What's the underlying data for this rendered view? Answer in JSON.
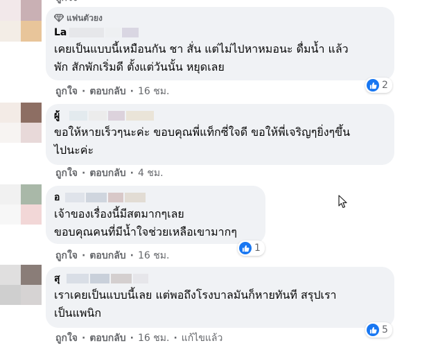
{
  "comments": [
    {
      "badge": "แฟนตัวยง",
      "name": "La",
      "text": "เคยเป็นแบบนี้เหมือนกัน ชา สั่น แต่ไม่ไปหาหมอนะ ดื่มน้ำ แล้ว\nพัก สักพักเริ่มดี ตั้งแต่วันนั้น หยุดเลย",
      "like_label": "ถูกใจ",
      "reply_label": "ตอบกลับ",
      "time": "16 ชม.",
      "reactions": "2"
    },
    {
      "name": "ผู้",
      "text": "ขอให้หายเร็วๆนะค่ะ ขอบคุณพี่แท็กซี่ใจดี ขอให้พี่เจริญๆยิ่งๆขึ้น\nไปนะค่ะ",
      "like_label": "ถูกใจ",
      "reply_label": "ตอบกลับ",
      "time": "4 ชม."
    },
    {
      "name": "อ",
      "text": "เจ้าของเรื่องนี้มีสตมากๆเลย\nขอบคุณคนที่มีน้ำใจช่วยเหลือเขามากๆ",
      "like_label": "ถูกใจ",
      "reply_label": "ตอบกลับ",
      "time": "16 ชม.",
      "reactions": "1"
    },
    {
      "name": "สุ",
      "text": "เราเคยเป็นแบบนี้เลย แต่พอถึงโรงบาลมันก็หายทันที สรุปเรา\nเป็นแพนิก",
      "like_label": "ถูกใจ",
      "reply_label": "ตอบกลับ",
      "time": "16 ชม.",
      "edited": "แก้ไขแล้ว",
      "reactions": "5"
    }
  ],
  "colors": {
    "bubble": "#f0f2f5",
    "meta": "#65676b",
    "like_blue": "#1877f2"
  },
  "icons": {
    "badge": "diamond-icon",
    "reaction": "thumbs-up-icon",
    "pointer": "mouse-cursor-icon"
  }
}
